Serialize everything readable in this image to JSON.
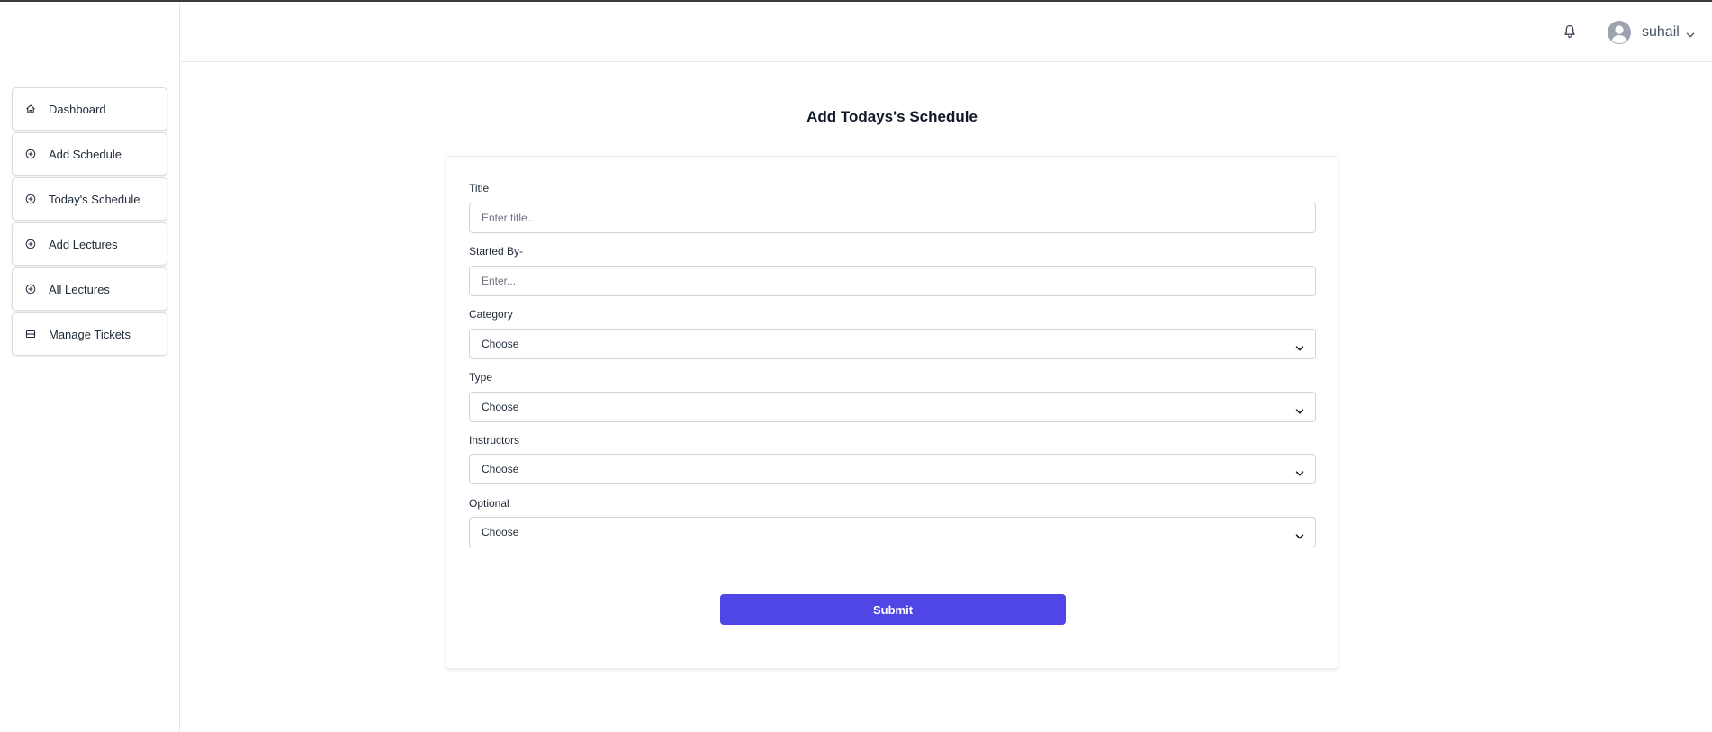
{
  "sidebar": {
    "items": [
      {
        "label": "Dashboard",
        "icon": "home-icon"
      },
      {
        "label": "Add Schedule",
        "icon": "plus-circle-icon"
      },
      {
        "label": "Today's Schedule",
        "icon": "plus-circle-icon"
      },
      {
        "label": "Add Lectures",
        "icon": "plus-circle-icon"
      },
      {
        "label": "All Lectures",
        "icon": "plus-circle-icon"
      },
      {
        "label": "Manage Tickets",
        "icon": "ticket-icon"
      }
    ]
  },
  "header": {
    "username": "suhail",
    "bell_icon": "bell-icon",
    "avatar_icon": "user-avatar-icon",
    "menu_icon": "chevron-down-icon"
  },
  "form": {
    "title": "Add Todays's Schedule",
    "fields": {
      "title": {
        "label": "Title",
        "placeholder": "Enter title.."
      },
      "started_by": {
        "label": "Started By-",
        "placeholder": "Enter..."
      },
      "category": {
        "label": "Category",
        "value": "Choose"
      },
      "type": {
        "label": "Type",
        "value": "Choose"
      },
      "instructors": {
        "label": "Instructors",
        "value": "Choose"
      },
      "optional": {
        "label": "Optional",
        "value": "Choose"
      }
    },
    "submit_label": "Submit"
  },
  "colors": {
    "accent": "#4f46e5",
    "border": "#d1d5db",
    "text": "#1f2937"
  }
}
